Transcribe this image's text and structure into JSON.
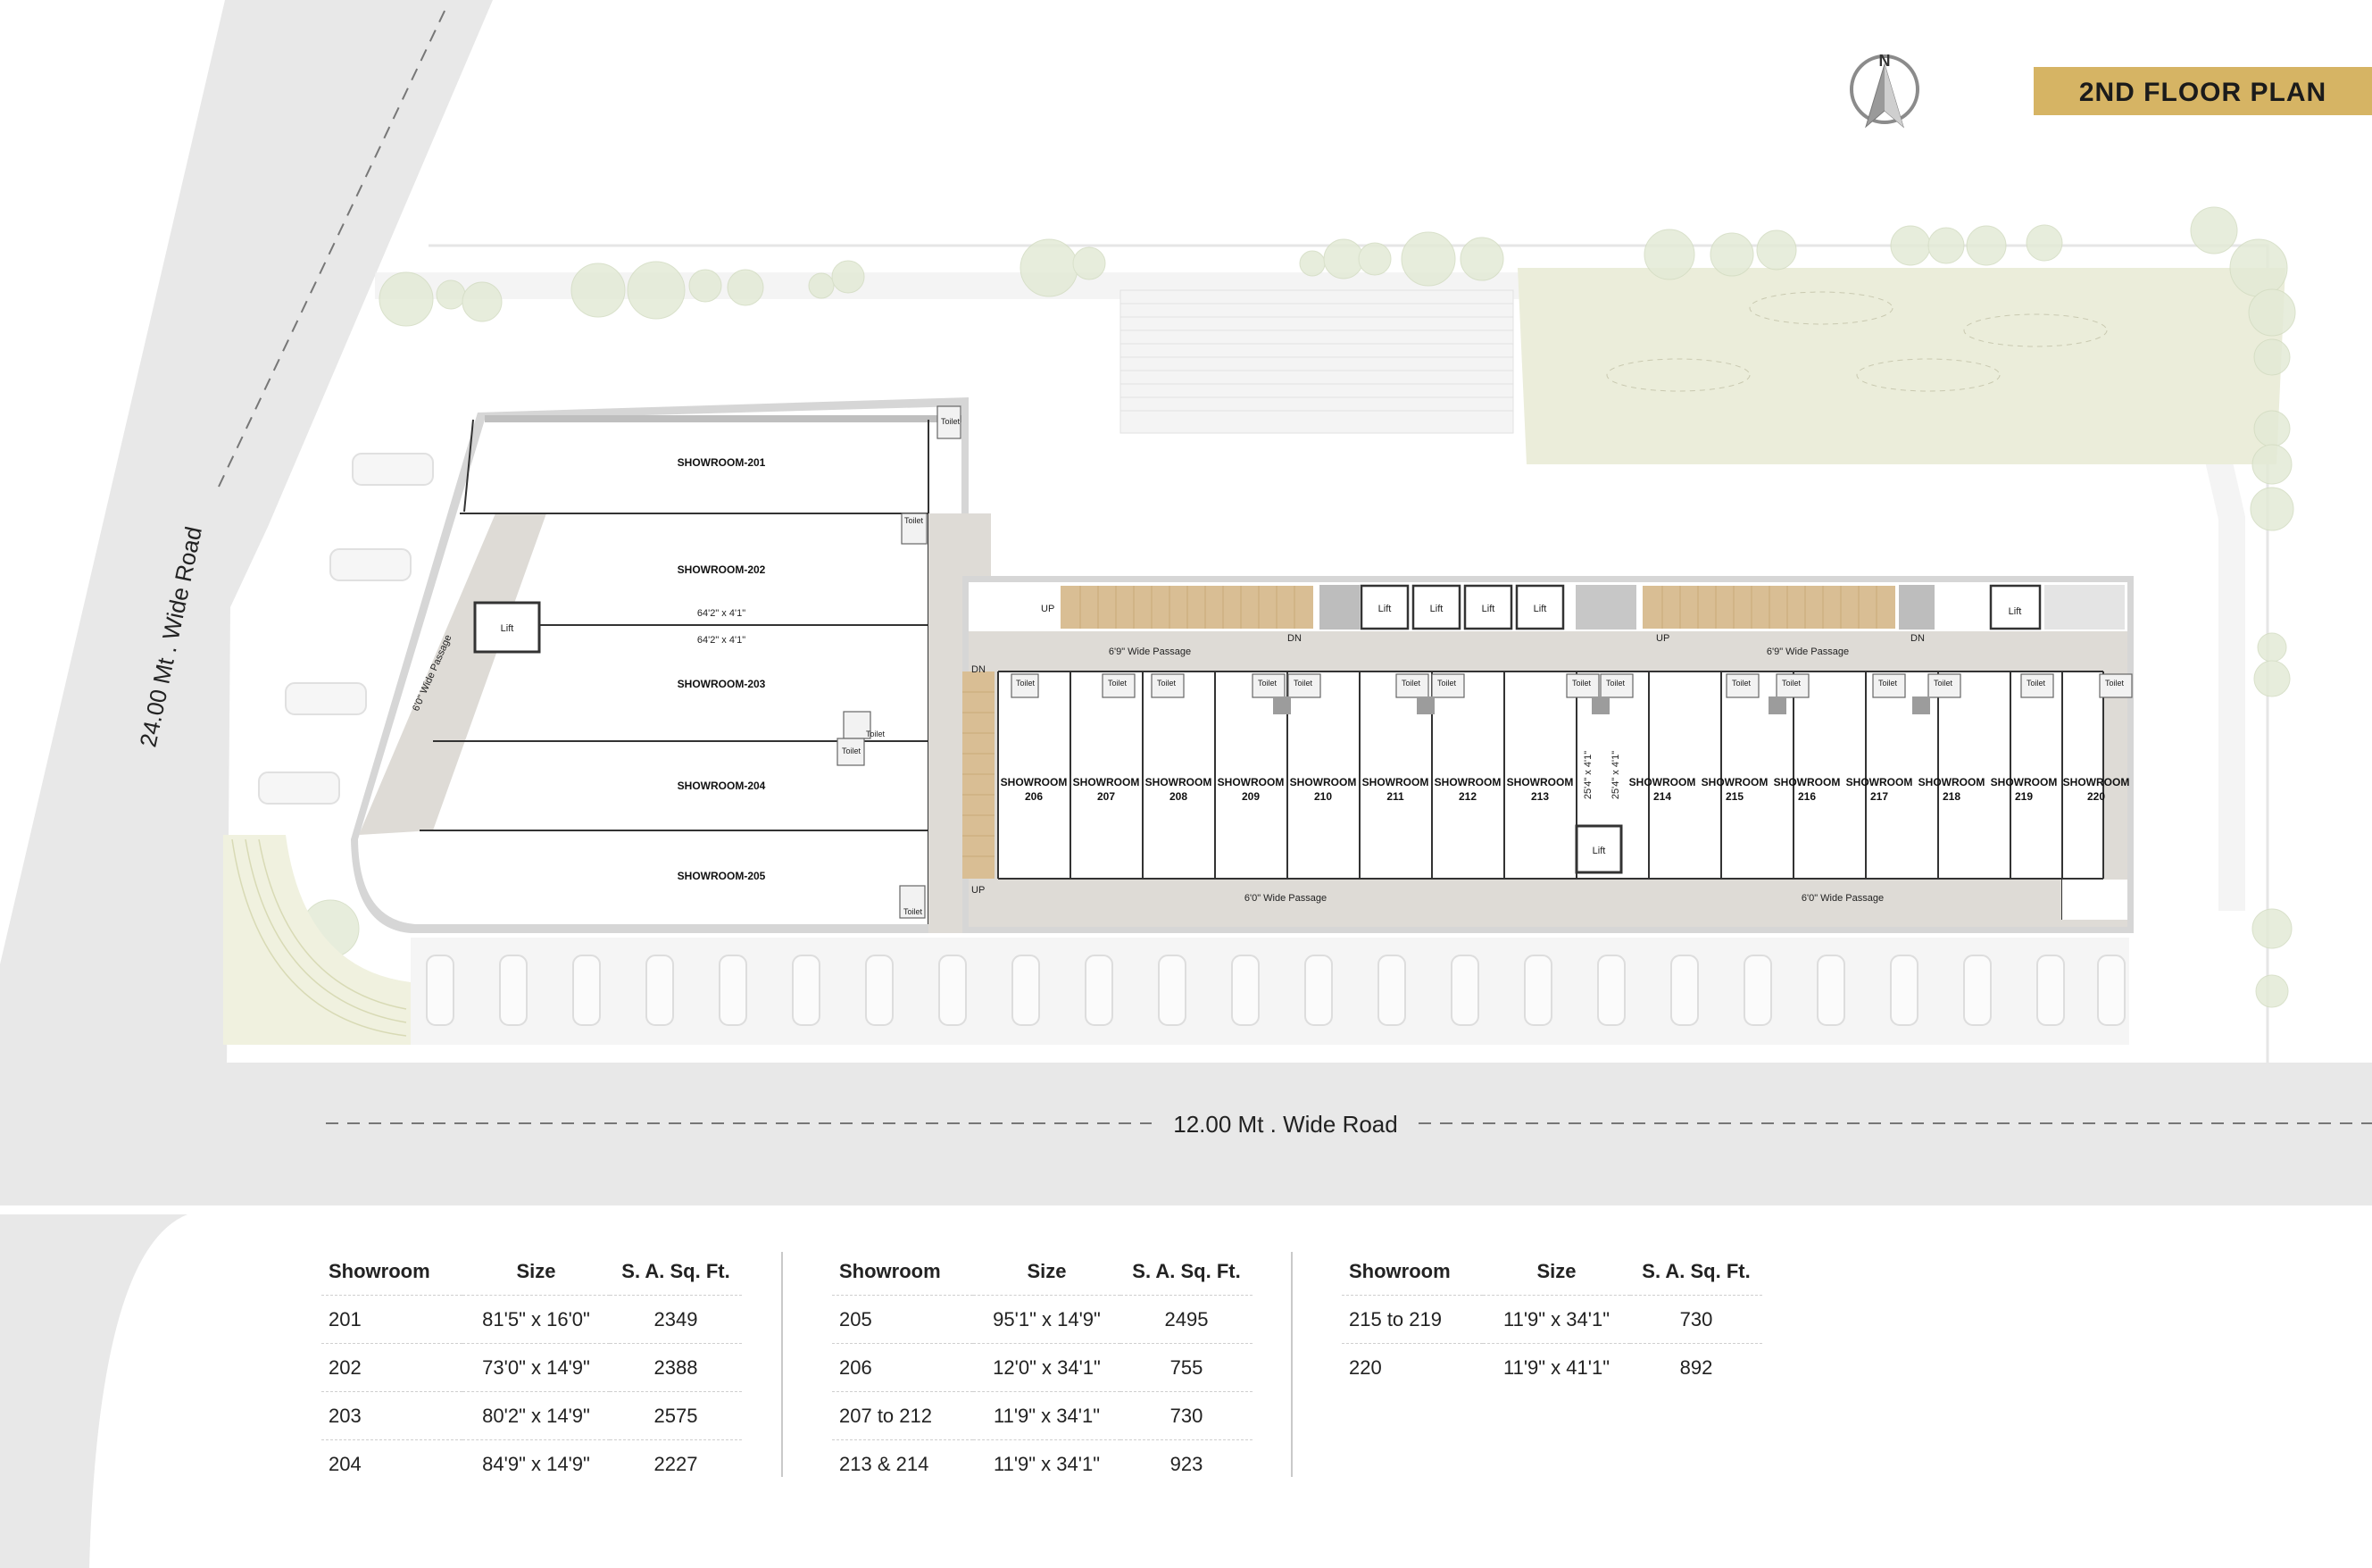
{
  "title": "2ND FLOOR PLAN",
  "compass": "N",
  "roads": {
    "left": "24.00 Mt . Wide Road",
    "bottom": "12.00 Mt . Wide Road"
  },
  "labels": {
    "passage_vertical": "6'0\" Wide Passage",
    "passage_top": "6'9\" Wide Passage",
    "passage_bottom": "6'0\" Wide Passage",
    "lift": "Lift",
    "toilet": "Toilet",
    "up": "UP",
    "dn": "DN",
    "dim_left": "64'2\" x 4'1\"",
    "dim_mid": "25'4\" x 4'1\""
  },
  "showrooms_left": [
    "SHOWROOM-201",
    "SHOWROOM-202",
    "SHOWROOM-203",
    "SHOWROOM-204",
    "SHOWROOM-205"
  ],
  "showroom_word": "SHOWROOM",
  "showrooms_row": [
    "206",
    "207",
    "208",
    "209",
    "210",
    "211",
    "212",
    "213",
    "214",
    "215",
    "216",
    "217",
    "218",
    "219",
    "220"
  ],
  "area_tables": {
    "headers": [
      "Showroom",
      "Size",
      "S. A. Sq. Ft."
    ],
    "groups": [
      [
        [
          "201",
          "81'5\" x 16'0\"",
          "2349"
        ],
        [
          "202",
          "73'0\" x 14'9\"",
          "2388"
        ],
        [
          "203",
          "80'2\" x 14'9\"",
          "2575"
        ],
        [
          "204",
          "84'9\" x 14'9\"",
          "2227"
        ]
      ],
      [
        [
          "205",
          "95'1\" x 14'9\"",
          "2495"
        ],
        [
          "206",
          "12'0\" x 34'1\"",
          "755"
        ],
        [
          "207 to 212",
          "11'9\" x 34'1\"",
          "730"
        ],
        [
          "213 & 214",
          "11'9\" x 34'1\"",
          "923"
        ]
      ],
      [
        [
          "215 to 219",
          "11'9\" x 34'1\"",
          "730"
        ],
        [
          "220",
          "11'9\" x 41'1\"",
          "892"
        ]
      ]
    ]
  },
  "colors": {
    "badge": "#d6b464",
    "stairs": "#d9be94",
    "lawn": "#ebedda",
    "road": "#e7e7e7",
    "passage": "#dedbd6"
  }
}
